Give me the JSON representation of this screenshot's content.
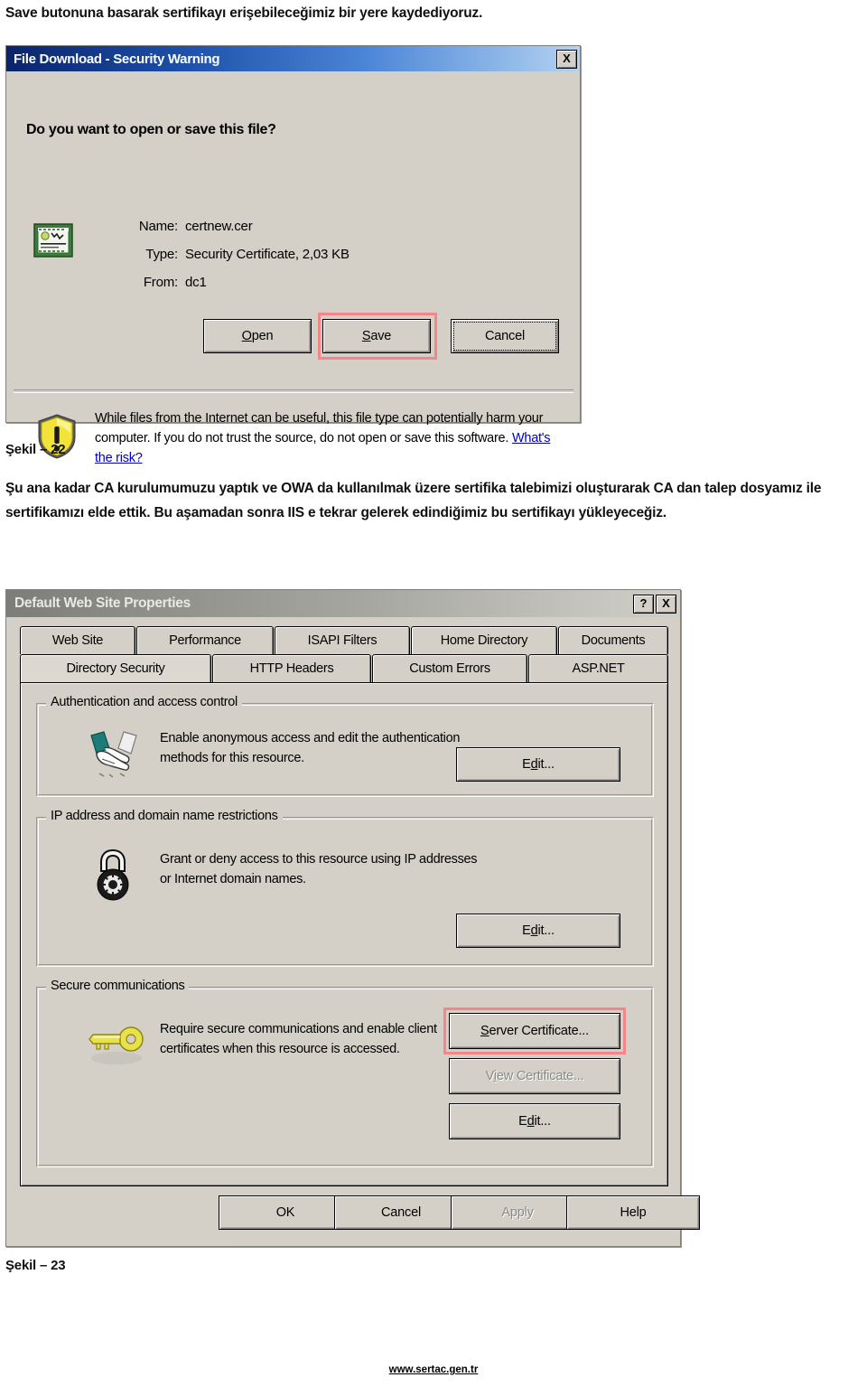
{
  "document": {
    "intro_paragraph": "Save butonuna basarak sertifikayı erişebileceğimiz bir yere kaydediyoruz.",
    "figure_22_caption": "Şekil – 22",
    "body_paragraph": "Şu ana kadar CA kurulumumuzu yaptık ve OWA da kullanılmak üzere sertifika talebimizi oluşturarak CA dan talep dosyamız ile sertifikamızı elde ettik. Bu aşamadan sonra IIS e tekrar gelerek edindiğimiz bu sertifikayı yükleyeceğiz.",
    "figure_23_caption": "Şekil – 23",
    "footer_url": "www.sertac.gen.tr"
  },
  "file_download_dialog": {
    "title": "File Download - Security Warning",
    "close_label": "X",
    "question": "Do you want to open or save this file?",
    "fields": [
      {
        "label": "Name:",
        "value": "certnew.cer"
      },
      {
        "label": "Type:",
        "value": "Security Certificate, 2,03 KB"
      },
      {
        "label": "From:",
        "value": "dc1"
      }
    ],
    "buttons": {
      "open": "Open",
      "save": "Save",
      "cancel": "Cancel"
    },
    "warning_text": "While files from the Internet can be useful, this file type can potentially harm your computer. If you do not trust the source, do not open or save this software.",
    "warning_link": "What's the risk?",
    "icons": {
      "file": "certificate-file-icon",
      "warning": "yellow-shield-warning-icon"
    },
    "highlight_color": "#f4868a",
    "titlebar_color": "#0a246a"
  },
  "web_site_properties_dialog": {
    "title": "Default Web Site Properties",
    "help_label": "?",
    "close_label": "X",
    "tabs_row_1": [
      {
        "label": "Web Site",
        "active": false
      },
      {
        "label": "Performance",
        "active": false
      },
      {
        "label": "ISAPI Filters",
        "active": false
      },
      {
        "label": "Home Directory",
        "active": false
      },
      {
        "label": "Documents",
        "active": false
      }
    ],
    "tabs_row_2": [
      {
        "label": "Directory Security",
        "active": true
      },
      {
        "label": "HTTP Headers",
        "active": false
      },
      {
        "label": "Custom Errors",
        "active": false
      },
      {
        "label": "ASP.NET",
        "active": false
      }
    ],
    "groups": [
      {
        "title": "Authentication and access control",
        "description": "Enable anonymous access and edit the authentication methods for this resource.",
        "icon": "handshake-icon",
        "buttons": [
          {
            "label": "Edit...",
            "disabled": false
          }
        ]
      },
      {
        "title": "IP address and domain name restrictions",
        "description": "Grant or deny access to this resource using IP addresses or Internet domain names.",
        "icon": "padlock-icon",
        "buttons": [
          {
            "label": "Edit...",
            "disabled": false
          }
        ]
      },
      {
        "title": "Secure communications",
        "description": "Require secure communications and enable client certificates when this resource is accessed.",
        "icon": "key-icon",
        "buttons": [
          {
            "label": "Server Certificate...",
            "disabled": false,
            "highlighted": true
          },
          {
            "label": "View Certificate...",
            "disabled": true
          },
          {
            "label": "Edit...",
            "disabled": false
          }
        ]
      }
    ],
    "action_buttons": [
      {
        "label": "OK",
        "disabled": false
      },
      {
        "label": "Cancel",
        "disabled": false
      },
      {
        "label": "Apply",
        "disabled": true
      },
      {
        "label": "Help",
        "disabled": false
      }
    ],
    "highlight_color": "#f4868a",
    "titlebar_color": "#8d8d88"
  }
}
